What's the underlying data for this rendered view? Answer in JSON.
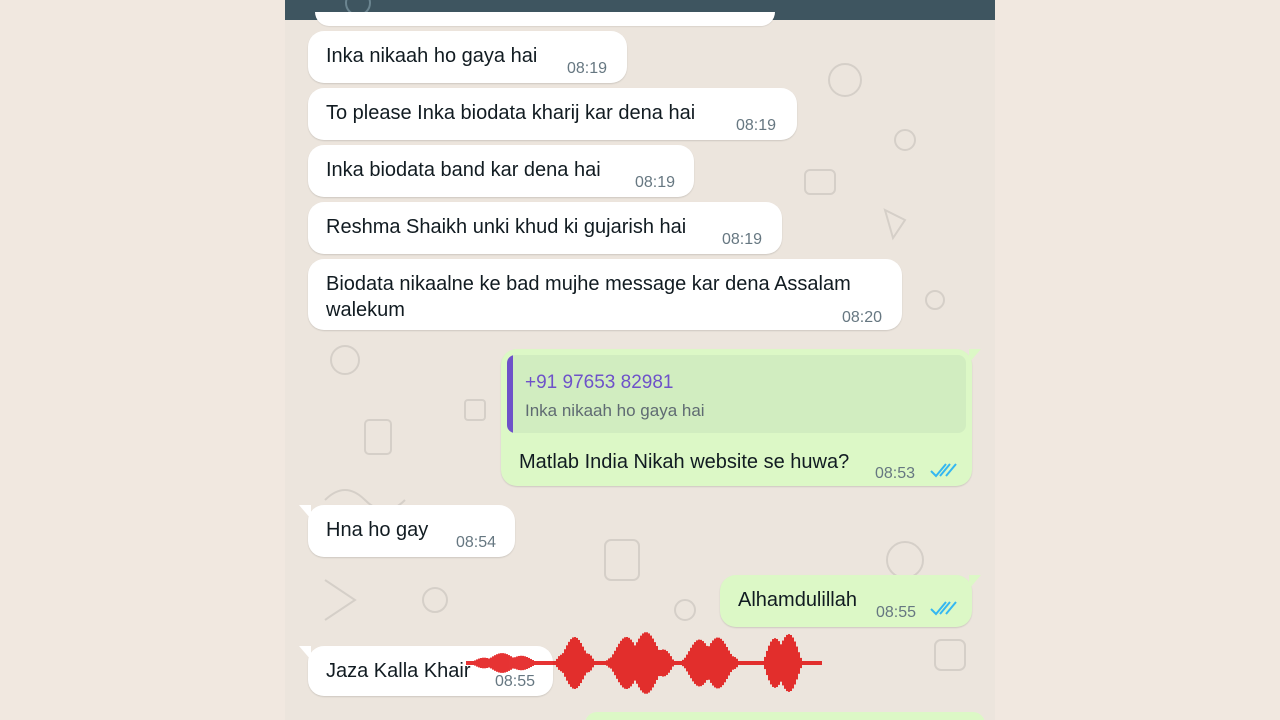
{
  "colors": {
    "header": "#3e5560",
    "chat_background": "#ece5dd",
    "incoming_bubble": "#ffffff",
    "outgoing_bubble": "#dcf8c6",
    "quote_accent": "#6e52c9",
    "read_ticks": "#34b7f1",
    "waveform": "#e00000"
  },
  "messages": [
    {
      "direction": "in",
      "text": "Inka nikaah ho gaya hai",
      "time": "08:19"
    },
    {
      "direction": "in",
      "text": "To please Inka biodata kharij kar dena hai",
      "time": "08:19"
    },
    {
      "direction": "in",
      "text": "Inka biodata band kar dena hai",
      "time": "08:19"
    },
    {
      "direction": "in",
      "text": "Reshma Shaikh unki khud ki gujarish hai",
      "time": "08:19"
    },
    {
      "direction": "in",
      "text": "Biodata nikaalne ke bad mujhe message kar dena Assalam walekum",
      "time": "08:20"
    },
    {
      "direction": "out",
      "quote": {
        "sender": "+91 97653 82981",
        "text": "Inka nikaah ho gaya hai"
      },
      "text": "Matlab India Nikah website se huwa?",
      "time": "08:53",
      "status_icon": "double-check-read-icon"
    },
    {
      "direction": "in",
      "text": "Hna ho gay",
      "time": "08:54"
    },
    {
      "direction": "out",
      "text": "Alhamdulillah",
      "time": "08:55",
      "status_icon": "double-check-read-icon"
    },
    {
      "direction": "in",
      "text": "Jaza Kalla Khair",
      "time": "08:55"
    }
  ],
  "overlay": {
    "icon": "audio-waveform-icon"
  }
}
